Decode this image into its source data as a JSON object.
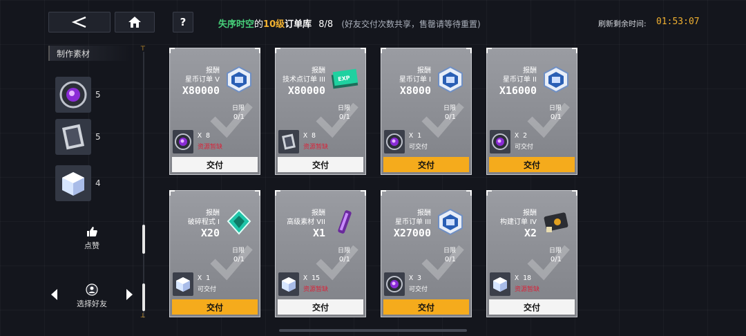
{
  "header": {
    "title_highlight": "失序时空",
    "title_mid": "的",
    "title_level": "10级",
    "title_suffix": "订单库",
    "title_count": "8/8",
    "title_note": "(好友交付次数共享，售罄请等待重置)",
    "timer_label": "刷新剩余时间:",
    "timer_value": "01:53:07",
    "help_label": "?",
    "colors": {
      "highlight": "#47d07a",
      "level": "#f0b030",
      "accent": "#f5ab1c",
      "shortage": "#d8243a"
    }
  },
  "materials": {
    "title": "制作素材",
    "items": [
      {
        "icon": "purple-orb-icon",
        "count": "5"
      },
      {
        "icon": "data-chip-icon",
        "count": "5"
      },
      {
        "icon": "crystal-cube-icon",
        "count": "4"
      }
    ]
  },
  "sidebar": {
    "like_label": "点赞",
    "friend_label": "选择好友",
    "scroll_top": "⊤",
    "scroll_bottom": "⊥"
  },
  "orders": [
    {
      "label": "报酬",
      "name": "星币订单 V",
      "qty": "X80000",
      "reward_icon": "star-coin-order-icon",
      "daily_label": "日限",
      "daily": "0/1",
      "req_icon": "purple-orb-icon",
      "req_qty": "X 8",
      "status": "资源暂缺",
      "status_type": "short",
      "submit": "交付",
      "submit_style": "white"
    },
    {
      "label": "报酬",
      "name": "技术点订单 III",
      "qty": "X80000",
      "reward_icon": "exp-ticket-icon",
      "daily_label": "日限",
      "daily": "0/1",
      "req_icon": "data-chip-icon",
      "req_qty": "X 8",
      "status": "资源暂缺",
      "status_type": "short",
      "submit": "交付",
      "submit_style": "white"
    },
    {
      "label": "报酬",
      "name": "星币订单 I",
      "qty": "X8000",
      "reward_icon": "star-coin-order-icon",
      "daily_label": "日限",
      "daily": "0/1",
      "req_icon": "purple-orb-icon",
      "req_qty": "X 1",
      "status": "可交付",
      "status_type": "ok",
      "submit": "交付",
      "submit_style": "gold"
    },
    {
      "label": "报酬",
      "name": "星币订单 II",
      "qty": "X16000",
      "reward_icon": "star-coin-order-icon",
      "daily_label": "日限",
      "daily": "0/1",
      "req_icon": "purple-orb-icon",
      "req_qty": "X 2",
      "status": "可交付",
      "status_type": "ok",
      "submit": "交付",
      "submit_style": "gold"
    },
    {
      "label": "报酬",
      "name": "破碎程式 I",
      "qty": "X20",
      "reward_icon": "broken-program-icon",
      "daily_label": "日限",
      "daily": "0/1",
      "req_icon": "crystal-cube-icon",
      "req_qty": "X 1",
      "status": "可交付",
      "status_type": "ok",
      "submit": "交付",
      "submit_style": "gold"
    },
    {
      "label": "报酬",
      "name": "高级素材 VII",
      "qty": "X1",
      "reward_icon": "purple-tube-icon",
      "daily_label": "日限",
      "daily": "0/1",
      "req_icon": "crystal-cube-icon",
      "req_qty": "X 15",
      "status": "资源暂缺",
      "status_type": "short",
      "submit": "交付",
      "submit_style": "white"
    },
    {
      "label": "报酬",
      "name": "星币订单 III",
      "qty": "X27000",
      "reward_icon": "star-coin-order-icon",
      "daily_label": "日限",
      "daily": "0/1",
      "req_icon": "purple-orb-icon",
      "req_qty": "X 3",
      "status": "可交付",
      "status_type": "ok",
      "submit": "交付",
      "submit_style": "gold"
    },
    {
      "label": "报酬",
      "name": "构建订单 IV",
      "qty": "X2",
      "reward_icon": "build-order-icon",
      "daily_label": "日限",
      "daily": "0/1",
      "req_icon": "crystal-cube-icon",
      "req_qty": "X 18",
      "status": "资源暂缺",
      "status_type": "short",
      "submit": "交付",
      "submit_style": "white"
    }
  ]
}
